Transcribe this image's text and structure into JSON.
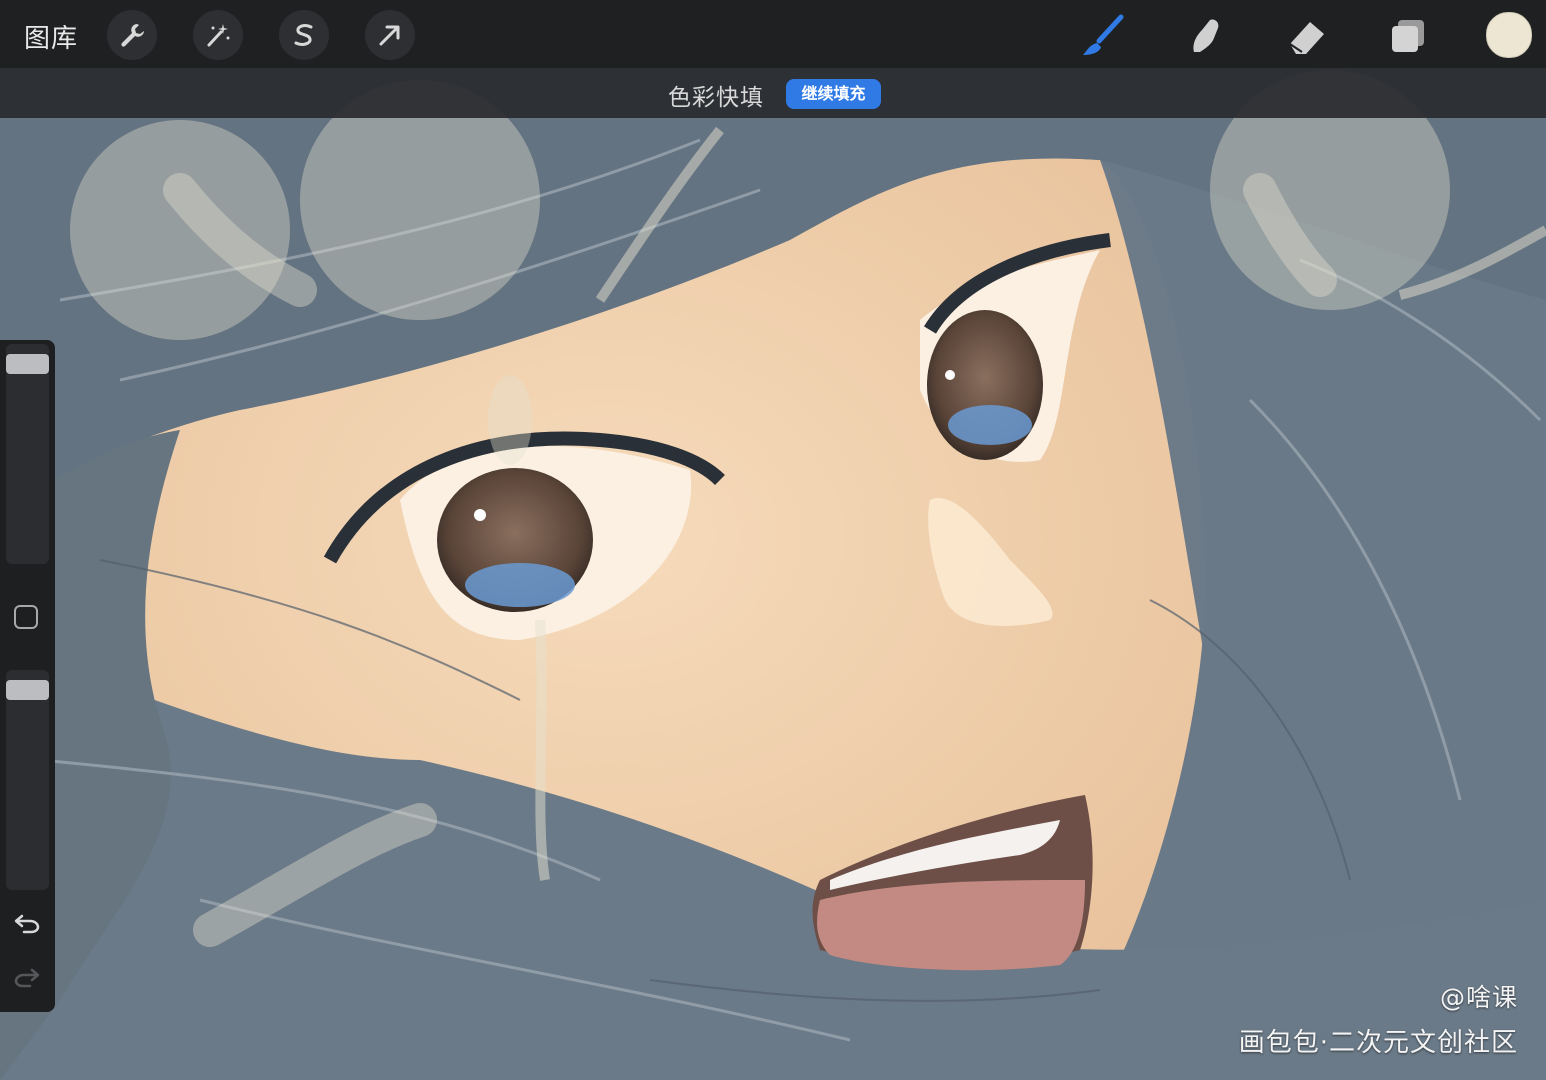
{
  "topbar": {
    "gallery_label": "图库",
    "tools_left": [
      "wrench-icon",
      "magic-wand-icon",
      "selection-icon",
      "transform-arrow-icon"
    ],
    "tools_right": [
      "brush-icon",
      "smudge-icon",
      "eraser-icon",
      "layers-icon"
    ],
    "active_tool": "brush-icon",
    "current_color": "#ece6d2"
  },
  "hint": {
    "label": "色彩快填",
    "button_label": "继续填充",
    "button_color": "#2f7ae5"
  },
  "sidebar": {
    "brush_size_level": 0.95,
    "opacity_level": 0.95
  },
  "watermark": {
    "line1": "@啥课",
    "line2": "画包包·二次元文创社区"
  },
  "colors": {
    "accent": "#2f7ae5",
    "toolbar": "#1f2022",
    "hair": "#6e7d8b",
    "skin": "#f0d3b0"
  }
}
